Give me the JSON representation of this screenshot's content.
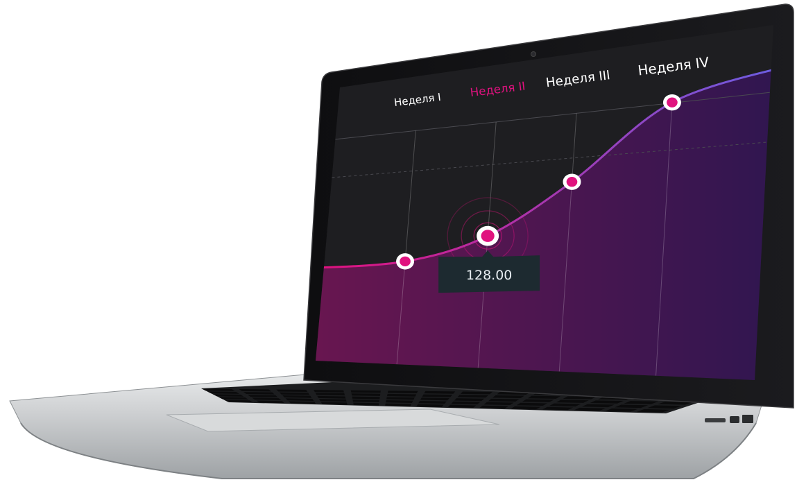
{
  "chart_data": {
    "type": "line",
    "title": "",
    "xlabel": "",
    "ylabel": "",
    "categories": [
      "Неделя I",
      "Неделя II",
      "Неделя III",
      "Неделя IV"
    ],
    "active_category_index": 1,
    "series": [
      {
        "values": [
          110,
          128,
          165,
          215
        ]
      }
    ],
    "tooltip": {
      "point_index": 1,
      "text": "128.00"
    },
    "grid": true,
    "legend": "none"
  },
  "colors": {
    "screen_bg": "#1e1e21",
    "active_label": "#e0127f",
    "label": "#ffffff",
    "line_start": "#e0127f",
    "line_end": "#6e5ce0",
    "area_start": "#6b1650",
    "area_end": "#2e1650",
    "tooltip_bg": "#1d2a30",
    "laptop_body": "#c9cbcd"
  },
  "icons": {
    "webcam": "camera-dot-icon",
    "ports": [
      "sd-slot-icon",
      "thunderbolt-port-icon",
      "usb-port-icon"
    ]
  }
}
